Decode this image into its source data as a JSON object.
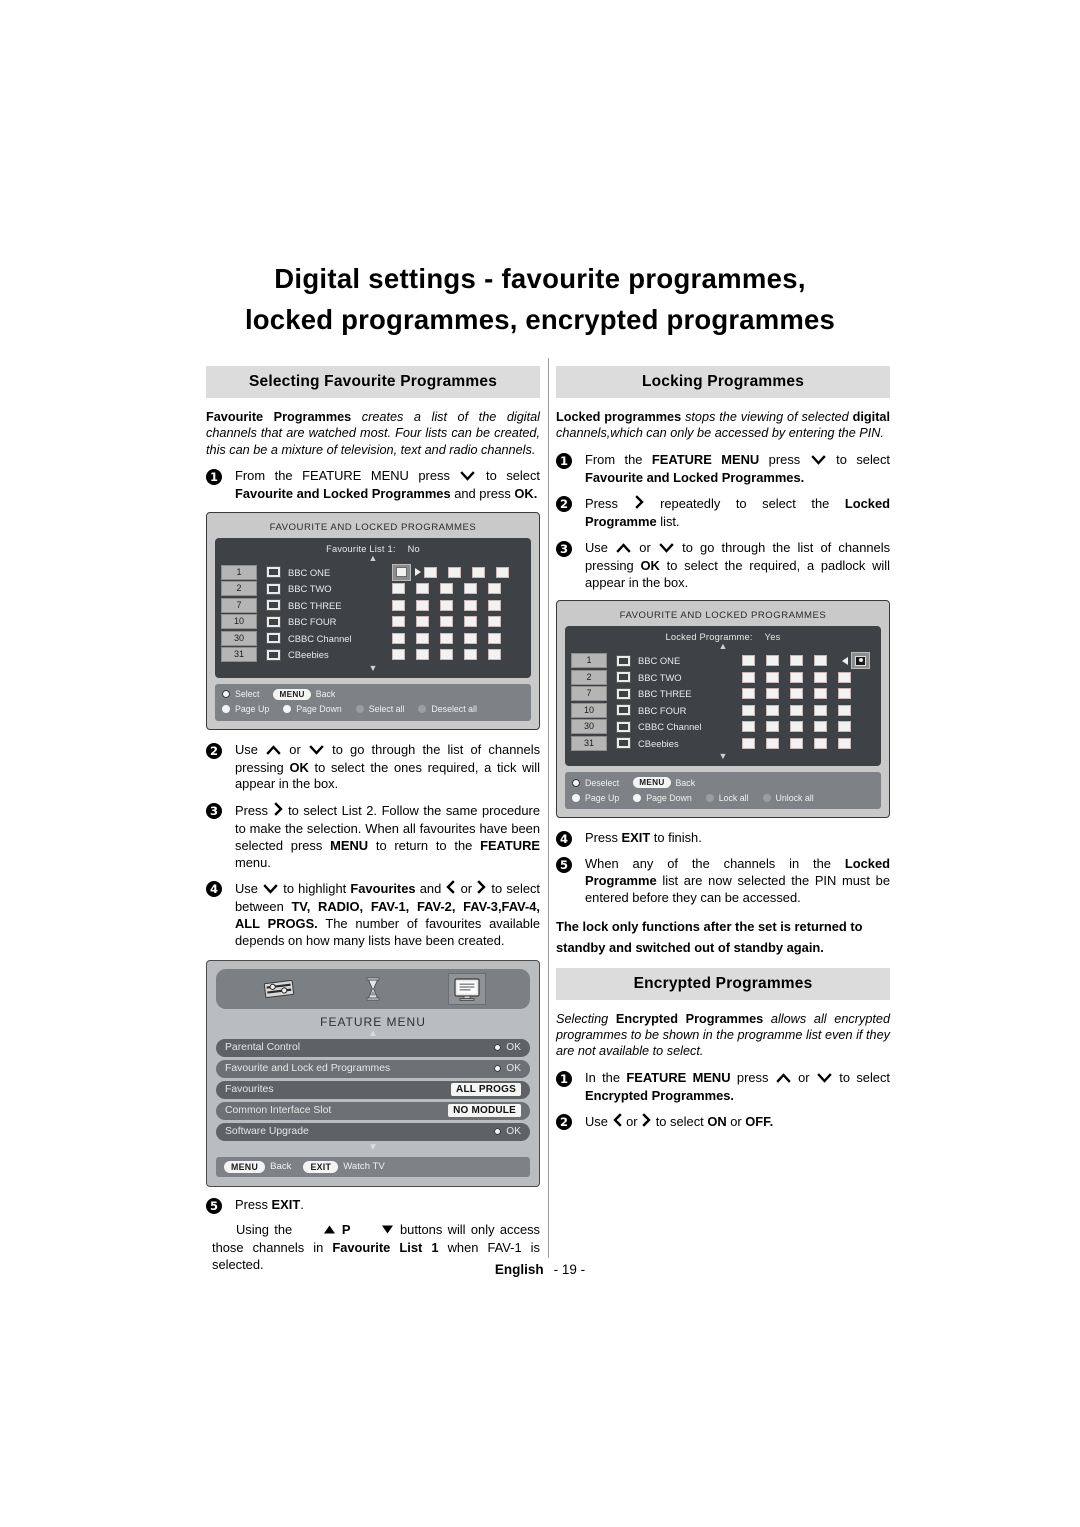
{
  "document": {
    "title_line1": "Digital settings - favourite programmes,",
    "title_line2": "locked programmes, encrypted programmes",
    "footer_language": "English",
    "footer_page": "- 19 -"
  },
  "left_column": {
    "section_heading": "Selecting Favourite Programmes",
    "intro": {
      "bold_lead": "Favourite Programmes",
      "rest": " creates a list of the digital channels that are watched most. Four lists can be created, this can be a mixture of television, text and radio channels."
    },
    "steps": [
      {
        "num": "1",
        "text_parts": [
          {
            "t": "From the FEATURE MENU press ",
            "style": "normal"
          },
          {
            "t": "chevron-down",
            "style": "icon"
          },
          {
            "t": " to select ",
            "style": "normal"
          },
          {
            "t": "Favourite and Locked Programmes",
            "style": "bold"
          },
          {
            "t": " and press ",
            "style": "normal"
          },
          {
            "t": "OK.",
            "style": "bold"
          }
        ]
      }
    ],
    "steps_after_screen": [
      {
        "num": "2",
        "text_parts": [
          {
            "t": "Use ",
            "style": "normal"
          },
          {
            "t": "chevron-up",
            "style": "icon"
          },
          {
            "t": " or ",
            "style": "normal"
          },
          {
            "t": "chevron-down",
            "style": "icon"
          },
          {
            "t": " to go through the list of channels pressing ",
            "style": "normal"
          },
          {
            "t": "OK",
            "style": "bold"
          },
          {
            "t": " to select the ones required, a tick will appear in the box.",
            "style": "normal"
          }
        ]
      },
      {
        "num": "3",
        "text_parts": [
          {
            "t": "Press ",
            "style": "normal"
          },
          {
            "t": "chevron-right",
            "style": "icon"
          },
          {
            "t": " to select List 2. Follow the same procedure to make the selection. When all favourites have been selected press ",
            "style": "normal"
          },
          {
            "t": "MENU",
            "style": "bold"
          },
          {
            "t": " to return to the ",
            "style": "normal"
          },
          {
            "t": "FEATURE",
            "style": "bold"
          },
          {
            "t": " menu.",
            "style": "normal"
          }
        ]
      },
      {
        "num": "4",
        "text_parts": [
          {
            "t": "Use ",
            "style": "normal"
          },
          {
            "t": "chevron-down",
            "style": "icon"
          },
          {
            "t": " to highlight ",
            "style": "normal"
          },
          {
            "t": "Favourites",
            "style": "bold"
          },
          {
            "t": " and ",
            "style": "normal"
          },
          {
            "t": "chevron-left",
            "style": "icon"
          },
          {
            "t": " or ",
            "style": "normal"
          },
          {
            "t": "chevron-right",
            "style": "icon"
          },
          {
            "t": " to select between ",
            "style": "normal"
          },
          {
            "t": "TV, RADIO, FAV-1, FAV-2, FAV-3,FAV-4, ALL PROGS.",
            "style": "bold"
          },
          {
            "t": " The number of favourites available depends on how many lists have been created.",
            "style": "normal"
          }
        ]
      }
    ],
    "final_step": {
      "num": "5",
      "text_parts": [
        {
          "t": "Press ",
          "style": "normal"
        },
        {
          "t": "EXIT",
          "style": "bold"
        },
        {
          "t": ".",
          "style": "normal"
        }
      ]
    },
    "final_note_parts": [
      {
        "t": "Using the ",
        "style": "normal"
      },
      {
        "t": "triangle-up",
        "style": "icon"
      },
      {
        "t": " P ",
        "style": "bold"
      },
      {
        "t": "triangle-down",
        "style": "icon"
      },
      {
        "t": " buttons will only access those channels in ",
        "style": "normal"
      },
      {
        "t": "Favourite List 1",
        "style": "bold"
      },
      {
        "t": " when FAV-1 is selected.",
        "style": "normal"
      }
    ]
  },
  "right_column": {
    "section_heading_locking": "Locking Programmes",
    "intro_locking": {
      "bold_lead": "Locked programmes",
      "mid": " stops the viewing of selected ",
      "bold_mid": "digital",
      "rest": " channels,which can only be accessed by entering the PIN."
    },
    "steps": [
      {
        "num": "1",
        "text_parts": [
          {
            "t": "From the ",
            "style": "normal"
          },
          {
            "t": "FEATURE MENU",
            "style": "bold"
          },
          {
            "t": " press ",
            "style": "normal"
          },
          {
            "t": "chevron-down",
            "style": "icon"
          },
          {
            "t": " to select ",
            "style": "normal"
          },
          {
            "t": "Favourite and Locked Programmes.",
            "style": "bold"
          }
        ]
      },
      {
        "num": "2",
        "text_parts": [
          {
            "t": "Press ",
            "style": "normal"
          },
          {
            "t": "chevron-right",
            "style": "icon"
          },
          {
            "t": " repeatedly to select the ",
            "style": "normal"
          },
          {
            "t": "Locked Programme",
            "style": "bold"
          },
          {
            "t": " list.",
            "style": "normal"
          }
        ]
      },
      {
        "num": "3",
        "text_parts": [
          {
            "t": "Use ",
            "style": "normal"
          },
          {
            "t": "chevron-up",
            "style": "icon"
          },
          {
            "t": " or ",
            "style": "normal"
          },
          {
            "t": "chevron-down",
            "style": "icon"
          },
          {
            "t": " to go through the list of channels pressing ",
            "style": "normal"
          },
          {
            "t": "OK",
            "style": "bold"
          },
          {
            "t": " to select the required, a padlock will appear in the box.",
            "style": "normal"
          }
        ]
      }
    ],
    "steps_after_screen": [
      {
        "num": "4",
        "text_parts": [
          {
            "t": "Press ",
            "style": "normal"
          },
          {
            "t": "EXIT",
            "style": "bold"
          },
          {
            "t": " to finish.",
            "style": "normal"
          }
        ]
      },
      {
        "num": "5",
        "text_parts": [
          {
            "t": "When any of the channels in the ",
            "style": "normal"
          },
          {
            "t": "Locked Programme",
            "style": "bold"
          },
          {
            "t": " list are now selected the PIN must be entered before they can be accessed.",
            "style": "normal"
          }
        ]
      }
    ],
    "bold_note": "The lock only functions after the set is returned to standby and switched out of standby again.",
    "section_heading_encrypted": "Encrypted Programmes",
    "intro_encrypted": {
      "lead": "Selecting ",
      "bold_lead": "Encrypted Programmes",
      "rest": " allows all encrypted programmes to be shown in the programme list even if they are not available to select."
    },
    "encrypted_steps": [
      {
        "num": "1",
        "text_parts": [
          {
            "t": "In the ",
            "style": "normal"
          },
          {
            "t": "FEATURE MENU",
            "style": "bold"
          },
          {
            "t": " press ",
            "style": "normal"
          },
          {
            "t": "chevron-up",
            "style": "icon"
          },
          {
            "t": " or ",
            "style": "normal"
          },
          {
            "t": "chevron-down",
            "style": "icon"
          },
          {
            "t": " to select ",
            "style": "normal"
          },
          {
            "t": "Encrypted Programmes.",
            "style": "bold"
          }
        ]
      },
      {
        "num": "2",
        "text_parts": [
          {
            "t": "Use ",
            "style": "normal"
          },
          {
            "t": "chevron-left",
            "style": "icon"
          },
          {
            "t": " or ",
            "style": "normal"
          },
          {
            "t": "chevron-right",
            "style": "icon"
          },
          {
            "t": " to select ",
            "style": "normal"
          },
          {
            "t": "ON",
            "style": "bold"
          },
          {
            "t": " or ",
            "style": "normal"
          },
          {
            "t": "OFF.",
            "style": "bold"
          }
        ]
      }
    ]
  },
  "tv_screen_favourite": {
    "title": "FAVOURITE AND LOCKED PROGRAMMES",
    "subtitle_label": "Favourite List 1:",
    "subtitle_value": "No",
    "channels": [
      {
        "number": "1",
        "name": "BBC ONE"
      },
      {
        "number": "2",
        "name": "BBC TWO"
      },
      {
        "number": "7",
        "name": "BBC THREE"
      },
      {
        "number": "10",
        "name": "BBC FOUR"
      },
      {
        "number": "30",
        "name": "CBBC Channel"
      },
      {
        "number": "31",
        "name": "CBeebies"
      }
    ],
    "column_count": 5,
    "cursor_row": 0,
    "cursor_col": 0,
    "cursor_side": "left",
    "footer_row1": [
      {
        "icon": "ok-dot",
        "label": "Select"
      },
      {
        "icon": "menu-key",
        "label": "Back"
      }
    ],
    "footer_row2": [
      {
        "icon": "dot-white",
        "label": "Page Up"
      },
      {
        "icon": "dot-white",
        "label": "Page Down"
      },
      {
        "icon": "dot-grey",
        "label": "Select all"
      },
      {
        "icon": "dot-grey",
        "label": "Deselect all"
      }
    ],
    "menu_key_label": "MENU"
  },
  "tv_screen_locked": {
    "title": "FAVOURITE AND LOCKED PROGRAMMES",
    "subtitle_label": "Locked Programme:",
    "subtitle_value": "Yes",
    "channels": [
      {
        "number": "1",
        "name": "BBC ONE"
      },
      {
        "number": "2",
        "name": "BBC TWO"
      },
      {
        "number": "7",
        "name": "BBC THREE"
      },
      {
        "number": "10",
        "name": "BBC FOUR"
      },
      {
        "number": "30",
        "name": "CBBC Channel"
      },
      {
        "number": "31",
        "name": "CBeebies"
      }
    ],
    "column_count": 5,
    "cursor_row": 0,
    "cursor_col": 4,
    "cursor_side": "right",
    "footer_row1": [
      {
        "icon": "ok-dot",
        "label": "Deselect"
      },
      {
        "icon": "menu-key",
        "label": "Back"
      }
    ],
    "footer_row2": [
      {
        "icon": "dot-white",
        "label": "Page Up"
      },
      {
        "icon": "dot-white",
        "label": "Page Down"
      },
      {
        "icon": "dot-grey",
        "label": "Lock all"
      },
      {
        "icon": "dot-grey",
        "label": "Unlock all"
      }
    ],
    "menu_key_label": "MENU"
  },
  "feature_menu_screen": {
    "icons": [
      "settings-sliders-icon",
      "hourglass-icon",
      "tv-screen-icon"
    ],
    "selected_icon_index": 2,
    "title": "FEATURE MENU",
    "rows": [
      {
        "label": "Parental Control",
        "value": "OK",
        "value_type": "ok"
      },
      {
        "label": "Favourite and Lock ed Programmes",
        "value": "OK",
        "value_type": "ok"
      },
      {
        "label": "Favourites",
        "value": "ALL PROGS",
        "value_type": "chip"
      },
      {
        "label": "Common Interface Slot",
        "value": "NO MODULE",
        "value_type": "chip"
      },
      {
        "label": "Software Upgrade",
        "value": "OK",
        "value_type": "ok"
      }
    ],
    "bottom_bar": [
      {
        "key": "MENU",
        "label": "Back"
      },
      {
        "key": "EXIT",
        "label": "Watch TV"
      }
    ]
  },
  "colors": {
    "section_heading_bg": "#dcdcdc",
    "tv_bezel": "#c9c9c9",
    "tv_panel": "#3e4146",
    "tv_footer": "#7e8287",
    "menu_row": "#5e6266"
  }
}
